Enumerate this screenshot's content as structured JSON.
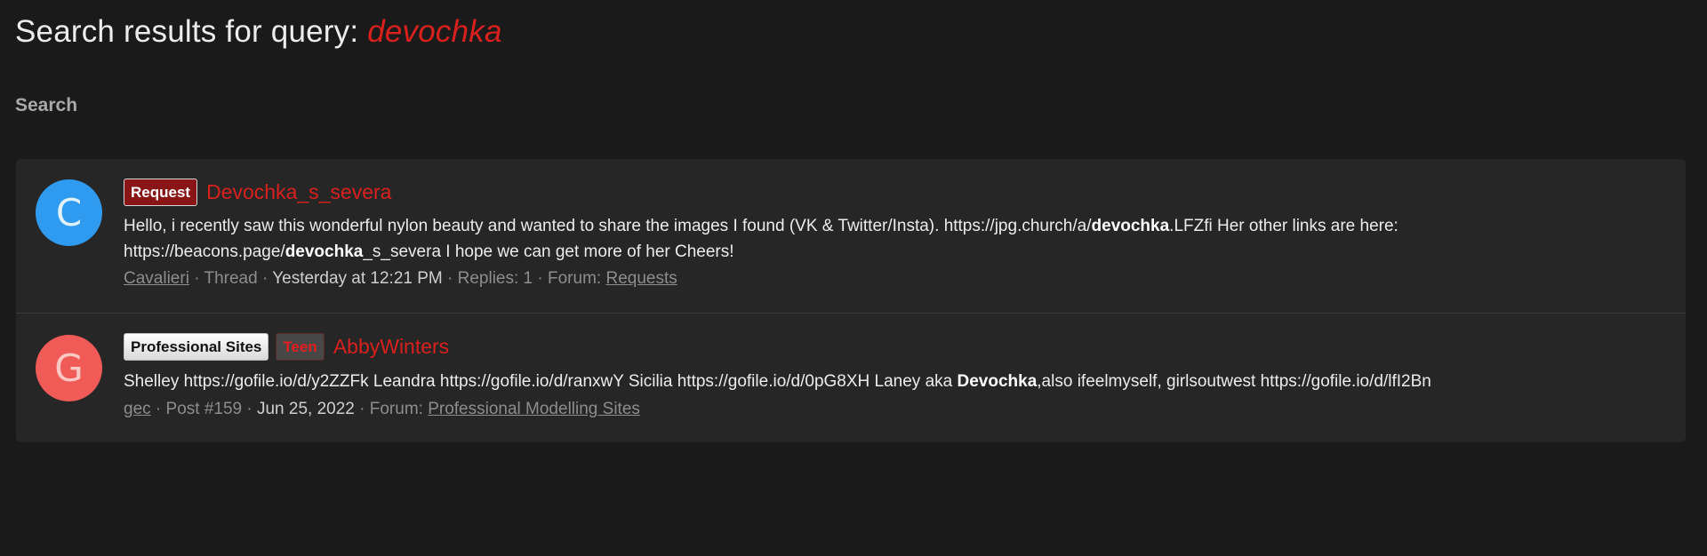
{
  "header": {
    "title_prefix": "Search results for query:",
    "query": "devochka"
  },
  "search_link": "Search",
  "results": [
    {
      "avatar_letter": "C",
      "avatar_color": "#2f9bf0",
      "labels": [
        "Request"
      ],
      "title": "Devochka_s_severa",
      "snippet": {
        "s1": "Hello, i recently saw this wonderful nylon beauty and wanted to share the images I found (VK & Twitter/Insta). https://jpg.church/a/",
        "b1": "devochka",
        "s2": ".LFZfi Her other links are here: https://beacons.page/",
        "b2": "devochka",
        "s3": "_s_severa I hope we can get more of her Cheers!"
      },
      "meta": {
        "author": "Cavalieri",
        "type": "· Thread ·",
        "time": "Yesterday at 12:21 PM",
        "replies": "· Replies: 1 · Forum:",
        "forum": "Requests"
      }
    },
    {
      "avatar_letter": "G",
      "avatar_color": "#f05b57",
      "labels": [
        "Professional Sites",
        "Teen"
      ],
      "title": "AbbyWinters",
      "snippet": {
        "s1": "Shelley https://gofile.io/d/y2ZZFk Leandra https://gofile.io/d/ranxwY Sicilia https://gofile.io/d/0pG8XH Laney aka ",
        "b1": "Devochka",
        "s2": ",also ifeelmyself, girlsoutwest https://gofile.io/d/lfI2Bn"
      },
      "meta": {
        "author": "gec",
        "type": "· Post #159 ·",
        "time": "Jun 25, 2022",
        "forum_prefix": "· Forum:",
        "forum": "Professional Modelling Sites"
      }
    }
  ]
}
